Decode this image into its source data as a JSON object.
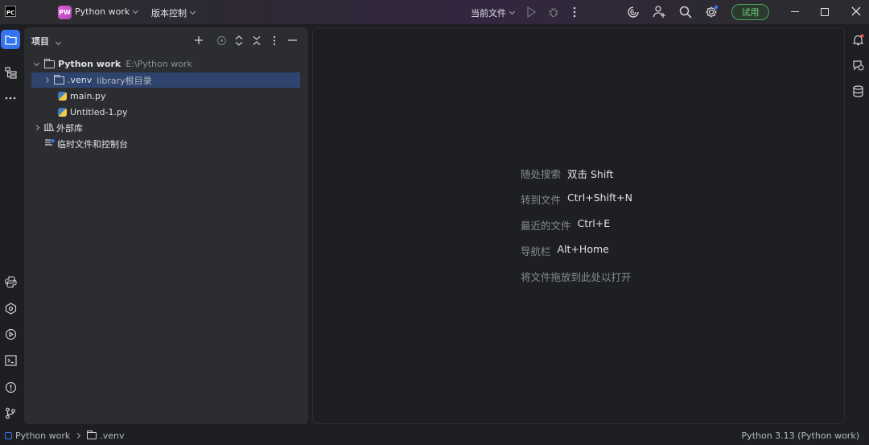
{
  "titlebar": {
    "logo_text": "PC",
    "project_badge": "PW",
    "project_name": "Python work",
    "vcs_label": "版本控制",
    "current_file_label": "当前文件",
    "trial_label": "试用"
  },
  "project_panel": {
    "title": "项目",
    "tree": [
      {
        "label": "Python work",
        "path": "E:\\Python work",
        "icon": "folder-icon",
        "expanded": true
      },
      {
        "label": ".venv",
        "note": "library根目录",
        "icon": "folder-icon",
        "expanded": false,
        "selected": true
      },
      {
        "label": "main.py",
        "icon": "python-file-icon"
      },
      {
        "label": "Untitled-1.py",
        "icon": "python-file-icon"
      },
      {
        "label": "外部库",
        "icon": "library-icon",
        "expanded": false
      },
      {
        "label": "临时文件和控制台",
        "icon": "scratches-icon"
      }
    ]
  },
  "editor": {
    "hints": [
      {
        "key": "随处搜索",
        "value": "双击 Shift"
      },
      {
        "key": "转到文件",
        "value": "Ctrl+Shift+N"
      },
      {
        "key": "最近的文件",
        "value": "Ctrl+E"
      },
      {
        "key": "导航栏",
        "value": "Alt+Home"
      },
      {
        "key": "将文件拖放到此处以打开",
        "value": ""
      }
    ]
  },
  "statusbar": {
    "crumb_project": "Python work",
    "crumb_folder": ".venv",
    "interpreter": "Python 3.13 (Python work)"
  },
  "colors": {
    "accent": "#3574f0",
    "selection": "#2e436e",
    "trial_green": "#6fd47d"
  }
}
